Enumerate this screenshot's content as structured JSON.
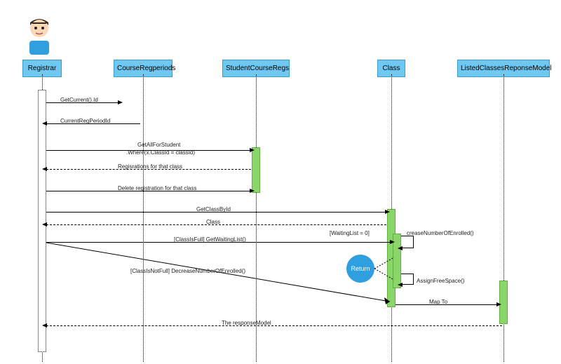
{
  "lifelines": {
    "l0": "Registrar",
    "l1": "CourseRegperiods",
    "l2": "StudentCourseRegs",
    "l3": "Class",
    "l4": "ListedClassesReponseModel"
  },
  "messages": {
    "m1": "GetCurrent().Id",
    "m2": "CurrentRegPeriodId",
    "m3a": "GetAllForStudent",
    "m3b": ".Where(x.ClassId = classId)",
    "m4": "Regisrations for that class",
    "m5": "Delete registration for that class",
    "m6": "GetClassById",
    "m7": "Class",
    "m8": "[ClassIsFull] GetWaitingList()",
    "m9": "[ClassIsNotFull] DecreaseNumberOfEnrolled()",
    "m10": "[WaitingList = 0]",
    "m10b": "creaseNumberOfEnrolled()",
    "m11": "AssignFreeSpace()",
    "m12": "Map To",
    "m13": "The responseModel",
    "return": "Return"
  }
}
